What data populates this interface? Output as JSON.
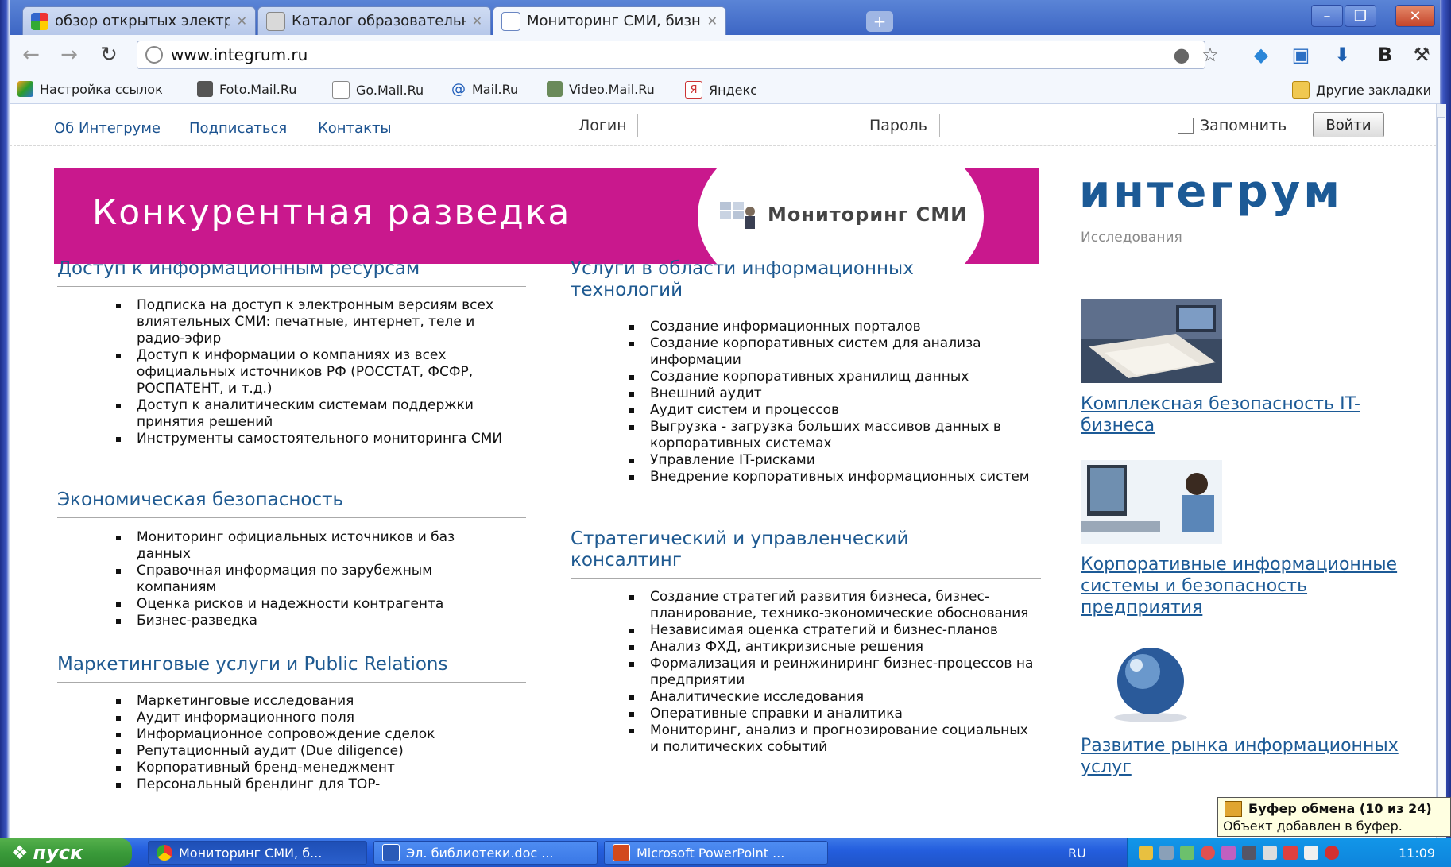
{
  "browser": {
    "tabs": [
      {
        "title": "обзор открытых электро...",
        "icon": "google-icon",
        "active": false
      },
      {
        "title": "Каталог образовательны...",
        "icon": "rp-icon",
        "active": false
      },
      {
        "title": "Мониторинг СМИ, бизнес-...",
        "icon": "page-icon",
        "active": true
      }
    ],
    "url": "www.integrum.ru",
    "bookmarks": [
      {
        "label": "Настройка ссылок",
        "icon": "star-icon"
      },
      {
        "label": "Foto.Mail.Ru",
        "icon": "camera-icon"
      },
      {
        "label": "Go.Mail.Ru",
        "icon": "page-icon"
      },
      {
        "label": "Mail.Ru",
        "icon": "at-icon"
      },
      {
        "label": "Video.Mail.Ru",
        "icon": "video-icon"
      },
      {
        "label": "Яндекс",
        "icon": "yandex-icon"
      }
    ],
    "other_bookmarks": "Другие закладки"
  },
  "page": {
    "nav_links": [
      "Об Интегруме",
      "Подписаться",
      "Контакты"
    ],
    "login_label": "Логин",
    "password_label": "Пароль",
    "remember_label": "Запомнить",
    "login_button": "Войти",
    "banner_title": "Конкурентная разведка",
    "banner_subtitle": "Мониторинг СМИ",
    "logo": "интегрум",
    "logo_sub": "Исследования",
    "left_sections": [
      {
        "title": "Доступ к информационным ресурсам",
        "items": [
          "Подписка на доступ к электронным версиям всех влиятельных СМИ: печатные, интернет, теле и радио-эфир",
          "Доступ к информации о компаниях из всех официальных источников РФ (РОССТАТ, ФСФР, РОСПАТЕНТ, и т.д.)",
          "Доступ к аналитическим системам поддержки принятия решений",
          "Инструменты самостоятельного мониторинга СМИ"
        ]
      },
      {
        "title": "Экономическая безопасность",
        "items": [
          "Мониторинг официальных источников и баз данных",
          "Справочная информация по зарубежным компаниям",
          "Оценка рисков и надежности контрагента",
          "Бизнес-разведка"
        ]
      },
      {
        "title": "Маркетинговые услуги и Public Relations",
        "items": [
          "Маркетинговые исследования",
          "Аудит информационного поля",
          "Информационное сопровождение сделок",
          "Репутационный аудит (Due diligence)",
          "Корпоративный бренд-менеджмент",
          "Персональный брендинг для TOP-"
        ]
      }
    ],
    "mid_sections": [
      {
        "title": "Услуги в области информационных технологий",
        "items": [
          "Создание информационных порталов",
          "Создание корпоративных систем для анализа информации",
          "Создание корпоративных хранилищ данных",
          "Внешний аудит",
          "Аудит систем и процессов",
          "Выгрузка - загрузка больших массивов данных в корпоративных системах",
          "Управление IT-рисками",
          "Внедрение корпоративных информационных систем"
        ]
      },
      {
        "title": "Стратегический и управленческий консалтинг",
        "items": [
          "Создание стратегий развития бизнеса, бизнес-планирование, технико-экономические обоснования",
          "Независимая оценка стратегий и бизнес-планов",
          "Анализ ФХД, антикризисные решения",
          "Формализация и реинжиниринг бизнес-процессов на предприятии",
          "Аналитические исследования",
          "Оперативные справки и аналитика",
          "Мониторинг, анализ и прогнозирование социальных и политических событий"
        ]
      }
    ],
    "side_links": [
      "Комплексная безопасность IT-бизнеса",
      "Корпоративные информационные системы и безопасность предприятия",
      "Развитие рынка информационных услуг"
    ]
  },
  "clipboard": {
    "title": "Буфер обмена (10 из 24)",
    "text": "Объект добавлен в буфер."
  },
  "taskbar": {
    "start": "пуск",
    "tasks": [
      {
        "label": "Мониторинг СМИ, б...",
        "icon": "chrome-icon"
      },
      {
        "label": "Эл. библиотеки.doc ...",
        "icon": "word-icon"
      },
      {
        "label": "Microsoft PowerPoint ...",
        "icon": "powerpoint-icon"
      }
    ],
    "lang": "RU",
    "clock": "11:09"
  },
  "colors": {
    "banner": "#c9188d",
    "link": "#1c5a96",
    "logo": "#1c5a96"
  }
}
